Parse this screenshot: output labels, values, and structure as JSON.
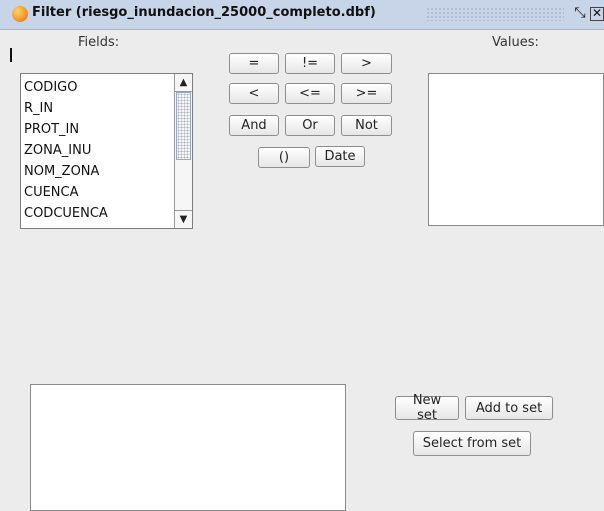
{
  "window": {
    "title": "Filter (riesgo_inundacion_25000_completo.dbf)",
    "icon": "gvsig-app-icon",
    "restore_icon": "⤡",
    "close_icon": "✕"
  },
  "fields_panel": {
    "label": "Fields:",
    "items": [
      "CODIGO",
      "R_IN",
      "PROT_IN",
      "ZONA_INU",
      "NOM_ZONA",
      "CUENCA",
      "CODCUENCA"
    ],
    "scroll_up": "▲",
    "scroll_down": "▼"
  },
  "operators": {
    "row1": [
      "=",
      "!=",
      ">"
    ],
    "row2": [
      "<",
      "<=",
      ">="
    ],
    "row3": [
      "And",
      "Or",
      "Not"
    ],
    "row4": [
      "()",
      "Date"
    ]
  },
  "values_panel": {
    "label": "Values:"
  },
  "actions": {
    "new_set": "New set",
    "add_to_set": "Add to set",
    "select_from_set": "Select from set"
  }
}
